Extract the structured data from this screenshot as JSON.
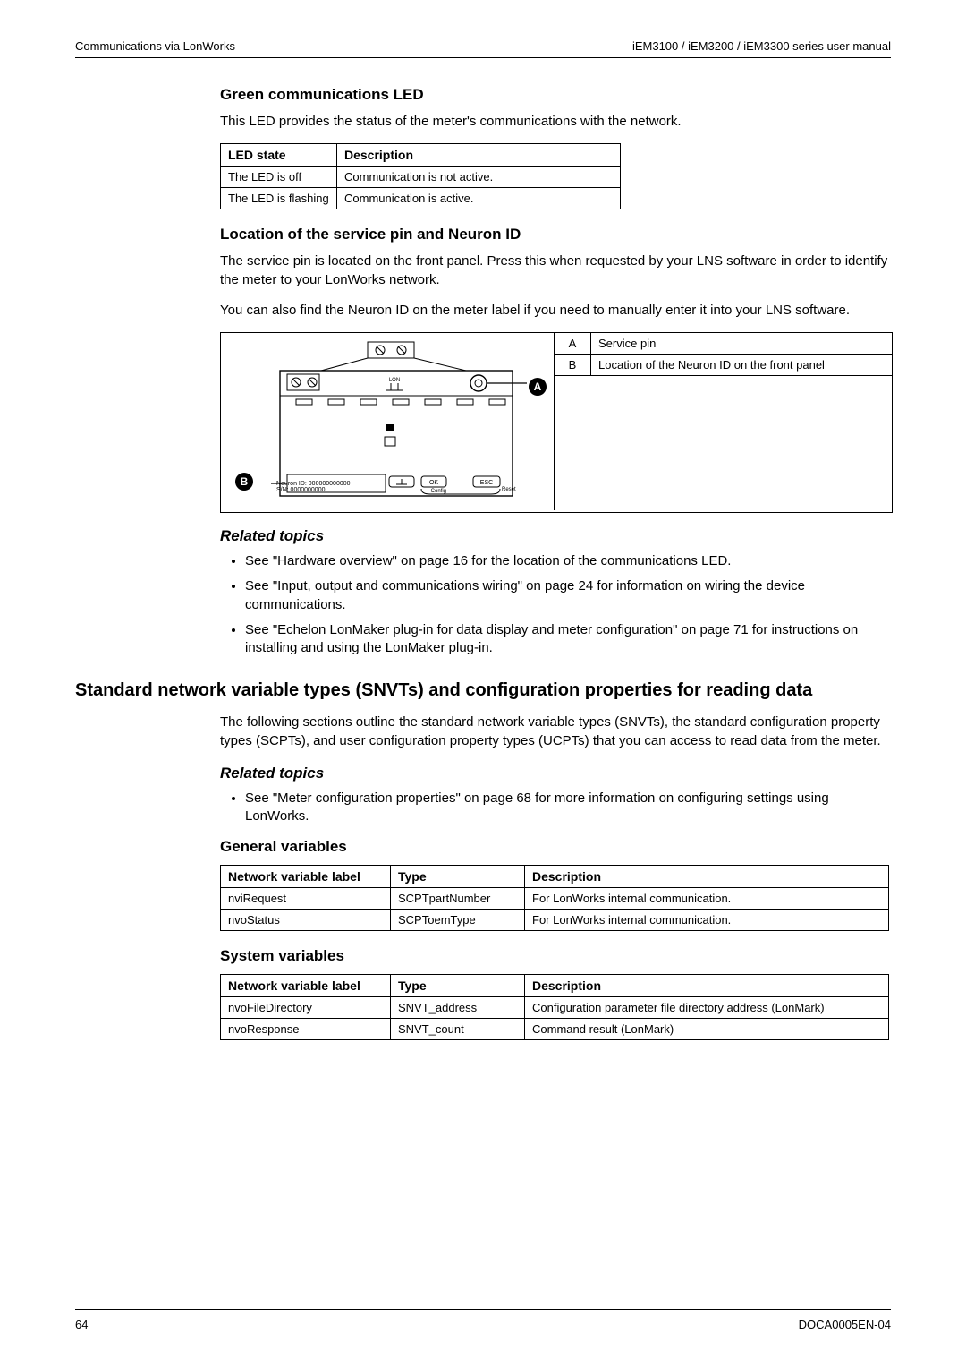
{
  "header": {
    "left": "Communications via LonWorks",
    "right": "iEM3100 / iEM3200 / iEM3300 series user manual"
  },
  "footer": {
    "page": "64",
    "doc": "DOCA0005EN-04"
  },
  "sec1": {
    "title": "Green communications LED",
    "intro": "This LED provides the status of the meter's communications with the network.",
    "table": {
      "h1": "LED state",
      "h2": "Description",
      "rows": [
        {
          "s": "The LED is off",
          "d": "Communication is not active."
        },
        {
          "s": "The LED is flashing",
          "d": "Communication is active."
        }
      ]
    }
  },
  "sec2": {
    "title": "Location of the service pin and Neuron ID",
    "p1": "The service pin is located on the front panel. Press this when requested by your LNS software in order to identify the meter to your LonWorks network.",
    "p2": "You can also find the Neuron ID on the meter label if you need to manually enter it into your LNS software.",
    "fig": {
      "a_label": "A",
      "a_text": "Service pin",
      "b_label": "B",
      "b_text": "Location of the Neuron ID on the front panel",
      "neuron1": "Neuron ID: 000000000000",
      "neuron2": "S/N: 0000000000",
      "lon": "LON",
      "btn_ok": "OK",
      "btn_esc": "ESC",
      "rst_config": "Config",
      "rst_reset": "Reset"
    },
    "related_title": "Related topics",
    "related": [
      "See \"Hardware overview\" on page 16 for the location of the communications LED.",
      "See \"Input, output and communications wiring\" on page 24 for information on wiring the device communications.",
      "See \"Echelon LonMaker plug-in for data display and meter configuration\" on page 71 for instructions on installing and using the LonMaker plug-in."
    ]
  },
  "sec3": {
    "title": "Standard network variable types (SNVTs) and configuration properties for reading data",
    "p": "The following sections outline the standard network variable types (SNVTs), the standard configuration property types (SCPTs), and user configuration property types (UCPTs) that you can access to read data from the meter.",
    "related_title": "Related topics",
    "related": [
      "See \"Meter configuration properties\" on page 68 for more information on configuring settings using LonWorks."
    ]
  },
  "sec4": {
    "title": "General variables",
    "h1": "Network variable label",
    "h2": "Type",
    "h3": "Description",
    "rows": [
      {
        "a": "nviRequest",
        "b": "SCPTpartNumber",
        "c": "For LonWorks internal communication."
      },
      {
        "a": "nvoStatus",
        "b": "SCPToemType",
        "c": "For LonWorks internal communication."
      }
    ]
  },
  "sec5": {
    "title": "System variables",
    "h1": "Network variable label",
    "h2": "Type",
    "h3": "Description",
    "rows": [
      {
        "a": "nvoFileDirectory",
        "b": "SNVT_address",
        "c": "Configuration parameter file directory address (LonMark)"
      },
      {
        "a": "nvoResponse",
        "b": "SNVT_count",
        "c": "Command result (LonMark)"
      }
    ]
  }
}
